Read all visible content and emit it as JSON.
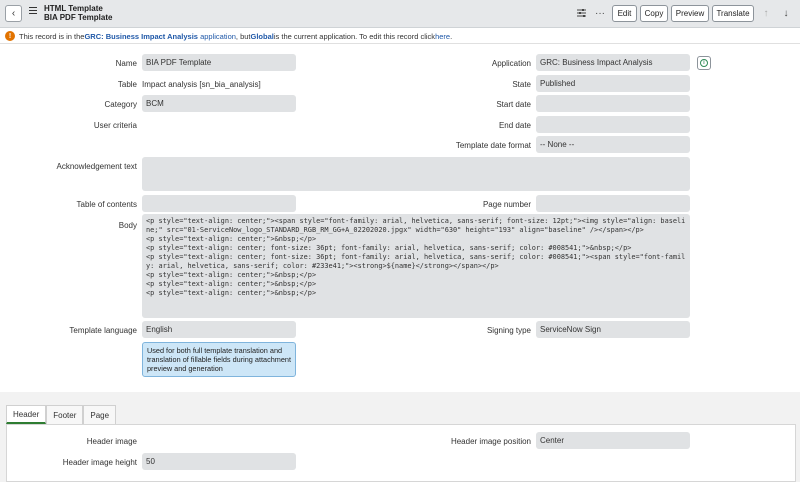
{
  "header": {
    "title_line1": "HTML Template",
    "title_line2": "BIA PDF Template",
    "buttons": {
      "edit": "Edit",
      "copy": "Copy",
      "preview": "Preview",
      "translate": "Translate"
    },
    "icons": {
      "back": "chevron-left-icon",
      "menu": "hamburger-icon",
      "settings": "sliders-icon",
      "more": "more-horizontal-icon",
      "up": "arrow-up-icon",
      "down": "arrow-down-icon"
    }
  },
  "banner": {
    "prefix": "This record is in the ",
    "app_name": "GRC: Business Impact Analysis",
    "app_link": "application",
    "middle": ", but ",
    "scope": "Global",
    "suffix": " is the current application. To edit this record click ",
    "here": "here",
    "end": "."
  },
  "form": {
    "name": {
      "label": "Name",
      "value": "BIA PDF Template"
    },
    "table": {
      "label": "Table",
      "value": "Impact analysis [sn_bia_analysis]"
    },
    "category": {
      "label": "Category",
      "value": "BCM"
    },
    "user_criteria": {
      "label": "User criteria",
      "value": ""
    },
    "acknowledgement": {
      "label": "Acknowledgement text",
      "value": ""
    },
    "table_of_contents": {
      "label": "Table of contents",
      "value": ""
    },
    "body": {
      "label": "Body",
      "value": "<p style=\"text-align: center;\"><span style=\"font-family: arial, helvetica, sans-serif; font-size: 12pt;\"><img style=\"align: baseline;\" src=\"01-ServiceNow_logo_STANDARD_RGB_RM_GG+A_02202020.jpgx\" width=\"630\" height=\"193\" align=\"baseline\" /></span></p>\n<p style=\"text-align: center;\">&nbsp;</p>\n<p style=\"text-align: center; font-size: 36pt; font-family: arial, helvetica, sans-serif; color: #008541;\">&nbsp;</p>\n<p style=\"text-align: center; font-size: 36pt; font-family: arial, helvetica, sans-serif; color: #008541;\"><span style=\"font-family: arial, helvetica, sans-serif; color: #233e41;\"><strong>${name}</strong></span></p>\n<p style=\"text-align: center;\">&nbsp;</p>\n<p style=\"text-align: center;\">&nbsp;</p>\n<p style=\"text-align: center;\">&nbsp;</p>"
    },
    "template_language": {
      "label": "Template language",
      "value": "English"
    },
    "language_help": "Used for both full template translation and translation of fillable fields during attachment preview and generation",
    "application": {
      "label": "Application",
      "value": "GRC: Business Impact Analysis"
    },
    "state": {
      "label": "State",
      "value": "Published"
    },
    "start_date": {
      "label": "Start date",
      "value": ""
    },
    "end_date": {
      "label": "End date",
      "value": ""
    },
    "template_date_format": {
      "label": "Template date format",
      "value": "-- None --"
    },
    "page_number": {
      "label": "Page number",
      "value": ""
    },
    "signing_type": {
      "label": "Signing type",
      "value": "ServiceNow Sign"
    }
  },
  "tabs": [
    {
      "label": "Header",
      "active": true
    },
    {
      "label": "Footer",
      "active": false
    },
    {
      "label": "Page",
      "active": false
    }
  ],
  "header_tab": {
    "header_image": {
      "label": "Header image",
      "value": ""
    },
    "header_image_height": {
      "label": "Header image height",
      "value": "50"
    },
    "header_image_position": {
      "label": "Header image position",
      "value": "Center"
    }
  },
  "colors": {
    "accent": "#1f58a8",
    "warning": "#e27300",
    "field_bg": "#e0e2e4",
    "active_tab": "#2e7d32"
  }
}
